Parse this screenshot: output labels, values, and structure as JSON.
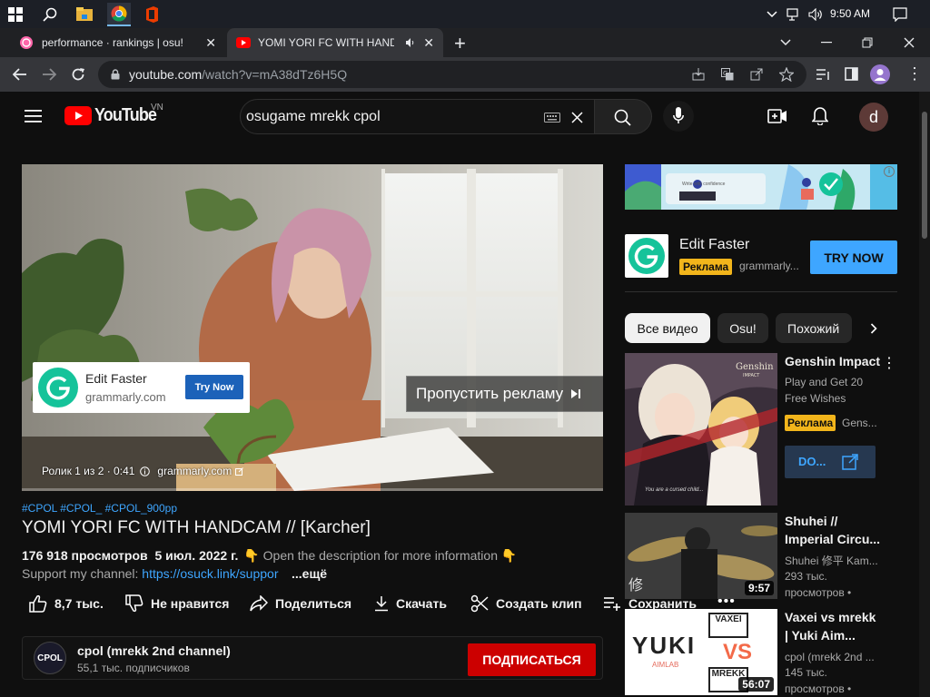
{
  "taskbar": {
    "time": "9:50 AM"
  },
  "tabs": [
    {
      "label": "performance · rankings | osu!"
    },
    {
      "label": "YOMI YORI FC WITH HANDCAM"
    }
  ],
  "address": {
    "domain": "youtube.com",
    "path": "/watch?v=mA38dTz6H5Q"
  },
  "header": {
    "logo_text": "YouTube",
    "region": "VN",
    "search_value": "osugame mrekk cpol",
    "avatar_letter": "d"
  },
  "player": {
    "ad_card": {
      "title": "Edit Faster",
      "domain": "grammarly.com",
      "button": "Try Now"
    },
    "skip_label": "Пропустить рекламу",
    "ad_info": "Ролик 1 из 2 · 0:41",
    "ad_domain": "grammarly.com",
    "progress": 0.0
  },
  "video": {
    "hashtags": "#CPOL #CPOL_ #CPOL_900pp",
    "title": "YOMI YORI FC WITH HANDCAM // [Karcher]",
    "views": "176 918 просмотров",
    "date": "5 июл. 2022 г.",
    "desc_line1": "Open the description for more information",
    "desc_line2_prefix": "Support my channel: ",
    "desc_link": "https://osuck.link/suppor",
    "more": "...ещё"
  },
  "actions": {
    "likes": "8,7 тыс.",
    "dislike": "Не нравится",
    "share": "Поделиться",
    "download": "Скачать",
    "clip": "Создать клип",
    "save": "Сохранить"
  },
  "channel": {
    "name": "cpol (mrekk 2nd channel)",
    "subs": "55,1 тыс. подписчиков",
    "avatar_text": "CPOL",
    "subscribe": "ПОДПИСАТЬСЯ"
  },
  "side_ad": {
    "banner_text": "Write with confidence",
    "title": "Edit Faster",
    "badge": "Реклама",
    "domain": "grammarly...",
    "button": "TRY NOW"
  },
  "chips": [
    "Все видео",
    "Osu!",
    "Похожий"
  ],
  "recommendations": [
    {
      "title": "Genshin Impact",
      "meta1": "Play and Get 20",
      "meta2": "Free Wishes",
      "badge": "Реклама",
      "channel": "Gens...",
      "cta": "DO...",
      "thumb_caption": "You are a cursed child..."
    },
    {
      "title_l1": "Shuhei //",
      "title_l2": "Imperial Circu...",
      "channel": "Shuhei 修平 Kam...",
      "views": "293 тыс.",
      "views2": "просмотров •",
      "duration": "9:57"
    },
    {
      "title_l1": "Vaxei vs mrekk",
      "title_l2": "| Yuki Aim...",
      "channel": "cpol (mrekk 2nd ...",
      "views": "145 тыс.",
      "views2": "просмотров •",
      "duration": "56:07",
      "thumb_text_a": "YUKI",
      "thumb_text_b": "AIMLAB",
      "thumb_vs": "VS",
      "thumb_name_a": "VAXEI",
      "thumb_name_b": "MREKK"
    }
  ]
}
